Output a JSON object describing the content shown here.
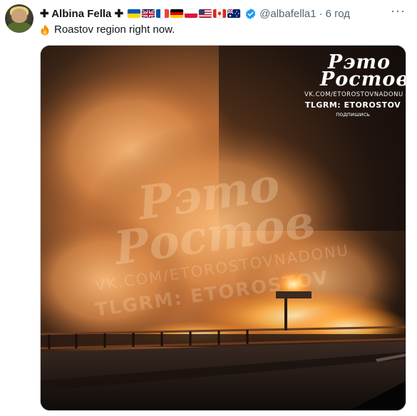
{
  "tweet": {
    "author_name": "Albina Fella",
    "name_prefix_symbol": "✚",
    "name_suffix_symbol": "✚",
    "flags": [
      "ukraine-flag",
      "uk-flag",
      "france-flag",
      "germany-flag",
      "poland-flag",
      "usa-flag",
      "canada-flag",
      "australia-flag"
    ],
    "verified_icon": "verified-badge-icon",
    "handle": "@albafella1",
    "separator": "·",
    "time": "6 год",
    "emoji_icon": "fire-icon",
    "text": "Roastov region right now.",
    "more_icon": "more-dots-icon",
    "more_label": "···"
  },
  "media": {
    "description_icon": "video-thumbnail-fire-bridge",
    "watermark": {
      "logo_line1": "Рэто",
      "logo_line2": "Ростов",
      "url": "VK.COM/ETOROSTOVNADONU",
      "telegram": "TLGRM: ETOROSTOV",
      "subscribe": "подпишись"
    }
  },
  "colors": {
    "text_primary": "#0f1419",
    "text_secondary": "#536471",
    "verified_blue": "#1d9bf0",
    "media_border": "#cfd9de"
  }
}
